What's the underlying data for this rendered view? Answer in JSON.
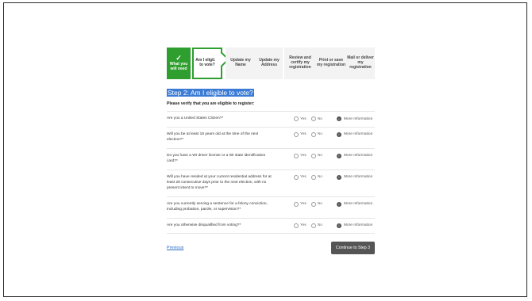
{
  "stepper": [
    {
      "label": "What you will need",
      "icon": "check-icon"
    },
    {
      "label": "Am I eligible to vote?"
    },
    {
      "label": "Update my Name"
    },
    {
      "label": "Update my Address"
    },
    {
      "label": "Review and certify my registration"
    },
    {
      "label": "Print or save my registration"
    },
    {
      "label": "Mail or deliver my registration"
    }
  ],
  "page": {
    "title": "Step 2: Am I eligible to vote?",
    "subtitle": "Please verify that you are eligible to register:"
  },
  "questions": [
    {
      "text": "Are you a United States Citizen?*"
    },
    {
      "text": "Will you be at least 18 years old at the time of the next election?*"
    },
    {
      "text": "Do you have a WI driver license or a WI state identification card?*"
    },
    {
      "text": "Will you have resided at your current residential address for at least 28 consecutive days prior to the next election, with no present intent to move?*"
    },
    {
      "text": "Are you currently serving a sentence for a felony conviction, including probation, parole, or supervision?*"
    },
    {
      "text": "Are you otherwise disqualified from voting?*"
    }
  ],
  "labels": {
    "yes": "Yes",
    "no": "No",
    "more_info": "More Information"
  },
  "footer": {
    "previous": "Previous",
    "continue": "Continue to Step 3"
  },
  "colors": {
    "accent_green": "#2e9e2e",
    "heading_blue": "#2a6cc4",
    "button_gray": "#555555"
  }
}
